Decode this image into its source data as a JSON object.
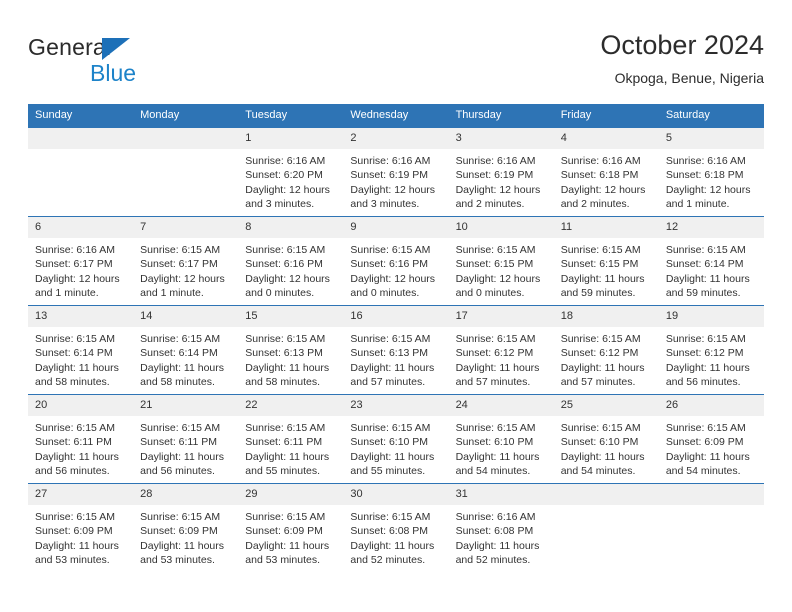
{
  "brand": {
    "name_top": "General",
    "name_bottom": "Blue",
    "accent_color": "#1d70b8",
    "blue_text_color": "#1d83c9"
  },
  "header": {
    "title": "October 2024",
    "subtitle": "Okpoga, Benue, Nigeria"
  },
  "theme": {
    "header_row_bg": "#2e74b5",
    "header_row_text": "#ffffff",
    "daynum_band_bg": "#f0f0f0",
    "cell_border": "#2e74b5",
    "body_text": "#333333"
  },
  "weekday_headers": [
    "Sunday",
    "Monday",
    "Tuesday",
    "Wednesday",
    "Thursday",
    "Friday",
    "Saturday"
  ],
  "labels": {
    "sunrise_prefix": "Sunrise:",
    "sunset_prefix": "Sunset:",
    "daylight_prefix": "Daylight:"
  },
  "weeks": [
    [
      {
        "day": "",
        "sunrise": "",
        "sunset": "",
        "daylight": ""
      },
      {
        "day": "",
        "sunrise": "",
        "sunset": "",
        "daylight": ""
      },
      {
        "day": "1",
        "sunrise": "Sunrise: 6:16 AM",
        "sunset": "Sunset: 6:20 PM",
        "daylight": "Daylight: 12 hours and 3 minutes."
      },
      {
        "day": "2",
        "sunrise": "Sunrise: 6:16 AM",
        "sunset": "Sunset: 6:19 PM",
        "daylight": "Daylight: 12 hours and 3 minutes."
      },
      {
        "day": "3",
        "sunrise": "Sunrise: 6:16 AM",
        "sunset": "Sunset: 6:19 PM",
        "daylight": "Daylight: 12 hours and 2 minutes."
      },
      {
        "day": "4",
        "sunrise": "Sunrise: 6:16 AM",
        "sunset": "Sunset: 6:18 PM",
        "daylight": "Daylight: 12 hours and 2 minutes."
      },
      {
        "day": "5",
        "sunrise": "Sunrise: 6:16 AM",
        "sunset": "Sunset: 6:18 PM",
        "daylight": "Daylight: 12 hours and 1 minute."
      }
    ],
    [
      {
        "day": "6",
        "sunrise": "Sunrise: 6:16 AM",
        "sunset": "Sunset: 6:17 PM",
        "daylight": "Daylight: 12 hours and 1 minute."
      },
      {
        "day": "7",
        "sunrise": "Sunrise: 6:15 AM",
        "sunset": "Sunset: 6:17 PM",
        "daylight": "Daylight: 12 hours and 1 minute."
      },
      {
        "day": "8",
        "sunrise": "Sunrise: 6:15 AM",
        "sunset": "Sunset: 6:16 PM",
        "daylight": "Daylight: 12 hours and 0 minutes."
      },
      {
        "day": "9",
        "sunrise": "Sunrise: 6:15 AM",
        "sunset": "Sunset: 6:16 PM",
        "daylight": "Daylight: 12 hours and 0 minutes."
      },
      {
        "day": "10",
        "sunrise": "Sunrise: 6:15 AM",
        "sunset": "Sunset: 6:15 PM",
        "daylight": "Daylight: 12 hours and 0 minutes."
      },
      {
        "day": "11",
        "sunrise": "Sunrise: 6:15 AM",
        "sunset": "Sunset: 6:15 PM",
        "daylight": "Daylight: 11 hours and 59 minutes."
      },
      {
        "day": "12",
        "sunrise": "Sunrise: 6:15 AM",
        "sunset": "Sunset: 6:14 PM",
        "daylight": "Daylight: 11 hours and 59 minutes."
      }
    ],
    [
      {
        "day": "13",
        "sunrise": "Sunrise: 6:15 AM",
        "sunset": "Sunset: 6:14 PM",
        "daylight": "Daylight: 11 hours and 58 minutes."
      },
      {
        "day": "14",
        "sunrise": "Sunrise: 6:15 AM",
        "sunset": "Sunset: 6:14 PM",
        "daylight": "Daylight: 11 hours and 58 minutes."
      },
      {
        "day": "15",
        "sunrise": "Sunrise: 6:15 AM",
        "sunset": "Sunset: 6:13 PM",
        "daylight": "Daylight: 11 hours and 58 minutes."
      },
      {
        "day": "16",
        "sunrise": "Sunrise: 6:15 AM",
        "sunset": "Sunset: 6:13 PM",
        "daylight": "Daylight: 11 hours and 57 minutes."
      },
      {
        "day": "17",
        "sunrise": "Sunrise: 6:15 AM",
        "sunset": "Sunset: 6:12 PM",
        "daylight": "Daylight: 11 hours and 57 minutes."
      },
      {
        "day": "18",
        "sunrise": "Sunrise: 6:15 AM",
        "sunset": "Sunset: 6:12 PM",
        "daylight": "Daylight: 11 hours and 57 minutes."
      },
      {
        "day": "19",
        "sunrise": "Sunrise: 6:15 AM",
        "sunset": "Sunset: 6:12 PM",
        "daylight": "Daylight: 11 hours and 56 minutes."
      }
    ],
    [
      {
        "day": "20",
        "sunrise": "Sunrise: 6:15 AM",
        "sunset": "Sunset: 6:11 PM",
        "daylight": "Daylight: 11 hours and 56 minutes."
      },
      {
        "day": "21",
        "sunrise": "Sunrise: 6:15 AM",
        "sunset": "Sunset: 6:11 PM",
        "daylight": "Daylight: 11 hours and 56 minutes."
      },
      {
        "day": "22",
        "sunrise": "Sunrise: 6:15 AM",
        "sunset": "Sunset: 6:11 PM",
        "daylight": "Daylight: 11 hours and 55 minutes."
      },
      {
        "day": "23",
        "sunrise": "Sunrise: 6:15 AM",
        "sunset": "Sunset: 6:10 PM",
        "daylight": "Daylight: 11 hours and 55 minutes."
      },
      {
        "day": "24",
        "sunrise": "Sunrise: 6:15 AM",
        "sunset": "Sunset: 6:10 PM",
        "daylight": "Daylight: 11 hours and 54 minutes."
      },
      {
        "day": "25",
        "sunrise": "Sunrise: 6:15 AM",
        "sunset": "Sunset: 6:10 PM",
        "daylight": "Daylight: 11 hours and 54 minutes."
      },
      {
        "day": "26",
        "sunrise": "Sunrise: 6:15 AM",
        "sunset": "Sunset: 6:09 PM",
        "daylight": "Daylight: 11 hours and 54 minutes."
      }
    ],
    [
      {
        "day": "27",
        "sunrise": "Sunrise: 6:15 AM",
        "sunset": "Sunset: 6:09 PM",
        "daylight": "Daylight: 11 hours and 53 minutes."
      },
      {
        "day": "28",
        "sunrise": "Sunrise: 6:15 AM",
        "sunset": "Sunset: 6:09 PM",
        "daylight": "Daylight: 11 hours and 53 minutes."
      },
      {
        "day": "29",
        "sunrise": "Sunrise: 6:15 AM",
        "sunset": "Sunset: 6:09 PM",
        "daylight": "Daylight: 11 hours and 53 minutes."
      },
      {
        "day": "30",
        "sunrise": "Sunrise: 6:15 AM",
        "sunset": "Sunset: 6:08 PM",
        "daylight": "Daylight: 11 hours and 52 minutes."
      },
      {
        "day": "31",
        "sunrise": "Sunrise: 6:16 AM",
        "sunset": "Sunset: 6:08 PM",
        "daylight": "Daylight: 11 hours and 52 minutes."
      },
      {
        "day": "",
        "sunrise": "",
        "sunset": "",
        "daylight": ""
      },
      {
        "day": "",
        "sunrise": "",
        "sunset": "",
        "daylight": ""
      }
    ]
  ]
}
